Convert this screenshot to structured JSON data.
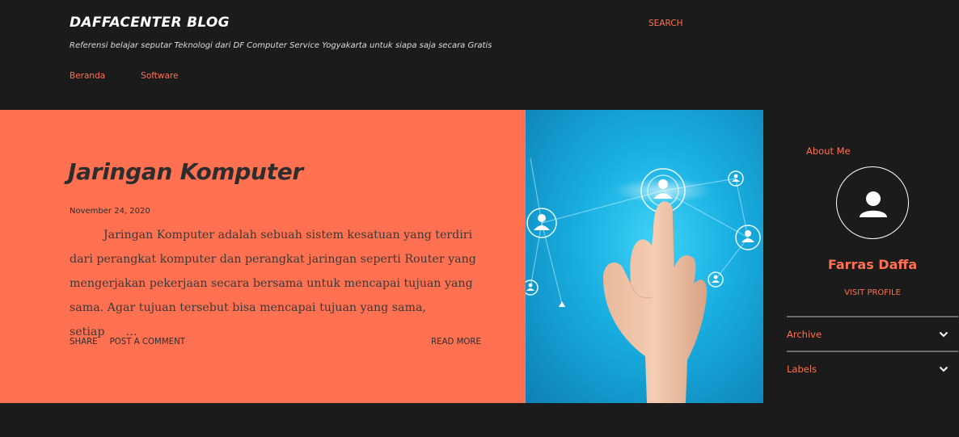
{
  "header": {
    "blog_title": "DAFFACENTER BLOG",
    "description": "Referensi belajar seputar Teknologi dari DF Computer Service Yogyakarta untuk siapa saja secara Gratis",
    "search_label": "SEARCH",
    "nav": [
      {
        "label": "Beranda"
      },
      {
        "label": "Software"
      }
    ]
  },
  "post": {
    "title": "Jaringan Komputer",
    "date": "November 24, 2020",
    "snippet": "Jaringan Komputer adalah sebuah sistem kesatuan yang terdiri dari perangkat komputer dan perangkat jaringan seperti Router yang mengerjakan pekerjaan secara bersama untuk mencapai tujuan yang sama. Agar tujuan tersebut bisa mencapai tujuan yang sama, setiap",
    "ellipsis": "…",
    "share_label": "SHARE",
    "comment_label": "POST A COMMENT",
    "read_more_label": "READ MORE"
  },
  "sidebar": {
    "about_title": "About Me",
    "profile_name": "Farras Daffa",
    "visit_profile_label": "VISIT PROFILE",
    "sections": [
      {
        "label": "Archive"
      },
      {
        "label": "Labels"
      }
    ]
  },
  "colors": {
    "page_bg": "#1b1b1b",
    "accent": "#ff7150",
    "card_text": "#2d2d2d",
    "divider": "#6e6e6e"
  },
  "icons": {
    "avatar": "default-user-icon",
    "expand": "chevron-down-icon"
  }
}
